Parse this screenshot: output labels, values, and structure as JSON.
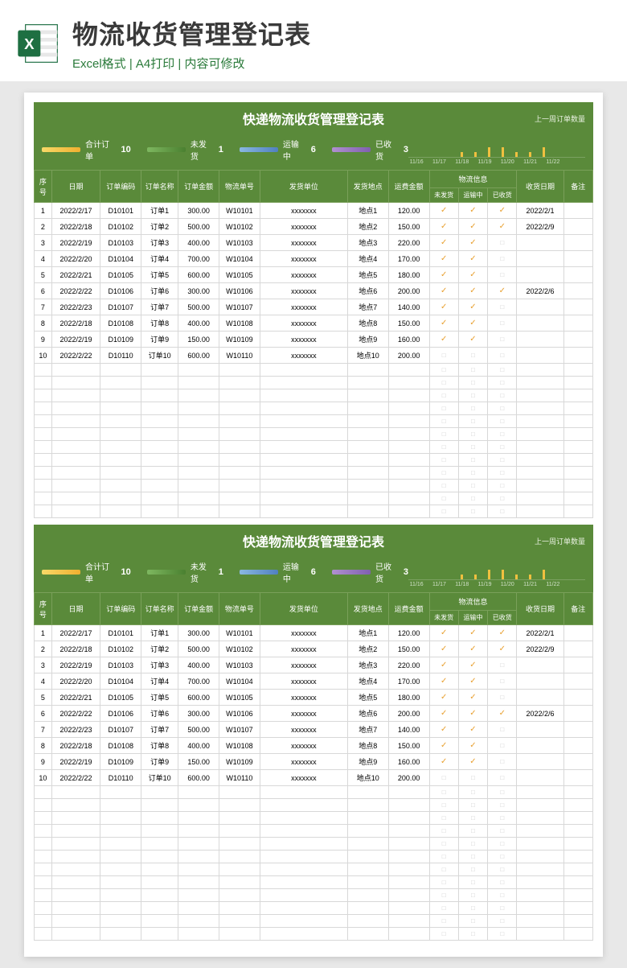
{
  "banner": {
    "main_title": "物流收货管理登记表",
    "sub_title": "Excel格式 | A4打印 | 内容可修改"
  },
  "sheet": {
    "title": "快递物流收货管理登记表",
    "chart_label": "上一周订单数量",
    "summary": {
      "total_label": "合计订单",
      "total_val": "10",
      "unship_label": "未发货",
      "unship_val": "1",
      "transit_label": "运输中",
      "transit_val": "6",
      "received_label": "已收货",
      "received_val": "3"
    },
    "chart_axis": [
      "11/16",
      "11/17",
      "11/18",
      "11/19",
      "11/20",
      "11/21",
      "11/22"
    ],
    "columns": {
      "seq": "序号",
      "date": "日期",
      "order_code": "订单编码",
      "order_name": "订单名称",
      "order_amt": "订单金额",
      "wl_code": "物流单号",
      "ship_unit": "发货单位",
      "ship_loc": "发货地点",
      "fee": "运费金额",
      "wl_group": "物流信息",
      "st_unship": "未发货",
      "st_transit": "运输中",
      "st_recv": "已收货",
      "recv_date": "收货日期",
      "note": "备注"
    },
    "rows": [
      {
        "seq": "1",
        "date": "2022/2/17",
        "code": "D10101",
        "name": "订单1",
        "amt": "300.00",
        "wl": "W10101",
        "unit": "xxxxxxx",
        "loc": "地点1",
        "fee": "120.00",
        "s1": "✓",
        "s2": "✓",
        "s3": "✓",
        "rdate": "2022/2/1"
      },
      {
        "seq": "2",
        "date": "2022/2/18",
        "code": "D10102",
        "name": "订单2",
        "amt": "500.00",
        "wl": "W10102",
        "unit": "xxxxxxx",
        "loc": "地点2",
        "fee": "150.00",
        "s1": "✓",
        "s2": "✓",
        "s3": "✓",
        "rdate": "2022/2/9"
      },
      {
        "seq": "3",
        "date": "2022/2/19",
        "code": "D10103",
        "name": "订单3",
        "amt": "400.00",
        "wl": "W10103",
        "unit": "xxxxxxx",
        "loc": "地点3",
        "fee": "220.00",
        "s1": "✓",
        "s2": "✓",
        "s3": "",
        "rdate": ""
      },
      {
        "seq": "4",
        "date": "2022/2/20",
        "code": "D10104",
        "name": "订单4",
        "amt": "700.00",
        "wl": "W10104",
        "unit": "xxxxxxx",
        "loc": "地点4",
        "fee": "170.00",
        "s1": "✓",
        "s2": "✓",
        "s3": "",
        "rdate": ""
      },
      {
        "seq": "5",
        "date": "2022/2/21",
        "code": "D10105",
        "name": "订单5",
        "amt": "600.00",
        "wl": "W10105",
        "unit": "xxxxxxx",
        "loc": "地点5",
        "fee": "180.00",
        "s1": "✓",
        "s2": "✓",
        "s3": "",
        "rdate": ""
      },
      {
        "seq": "6",
        "date": "2022/2/22",
        "code": "D10106",
        "name": "订单6",
        "amt": "300.00",
        "wl": "W10106",
        "unit": "xxxxxxx",
        "loc": "地点6",
        "fee": "200.00",
        "s1": "✓",
        "s2": "✓",
        "s3": "✓",
        "rdate": "2022/2/6"
      },
      {
        "seq": "7",
        "date": "2022/2/23",
        "code": "D10107",
        "name": "订单7",
        "amt": "500.00",
        "wl": "W10107",
        "unit": "xxxxxxx",
        "loc": "地点7",
        "fee": "140.00",
        "s1": "✓",
        "s2": "✓",
        "s3": "",
        "rdate": ""
      },
      {
        "seq": "8",
        "date": "2022/2/18",
        "code": "D10108",
        "name": "订单8",
        "amt": "400.00",
        "wl": "W10108",
        "unit": "xxxxxxx",
        "loc": "地点8",
        "fee": "150.00",
        "s1": "✓",
        "s2": "✓",
        "s3": "",
        "rdate": ""
      },
      {
        "seq": "9",
        "date": "2022/2/19",
        "code": "D10109",
        "name": "订单9",
        "amt": "150.00",
        "wl": "W10109",
        "unit": "xxxxxxx",
        "loc": "地点9",
        "fee": "160.00",
        "s1": "✓",
        "s2": "✓",
        "s3": "",
        "rdate": ""
      },
      {
        "seq": "10",
        "date": "2022/2/22",
        "code": "D10110",
        "name": "订单10",
        "amt": "600.00",
        "wl": "W10110",
        "unit": "xxxxxxx",
        "loc": "地点10",
        "fee": "200.00",
        "s1": "",
        "s2": "",
        "s3": "",
        "rdate": ""
      }
    ]
  },
  "chart_data": {
    "type": "bar",
    "categories": [
      "11/16",
      "11/17",
      "11/18",
      "11/19",
      "11/20",
      "11/21",
      "11/22"
    ],
    "values": [
      1,
      1,
      2,
      2,
      1,
      1,
      2
    ],
    "title": "上一周订单数量",
    "xlabel": "",
    "ylabel": "",
    "ylim": [
      0,
      3
    ]
  }
}
